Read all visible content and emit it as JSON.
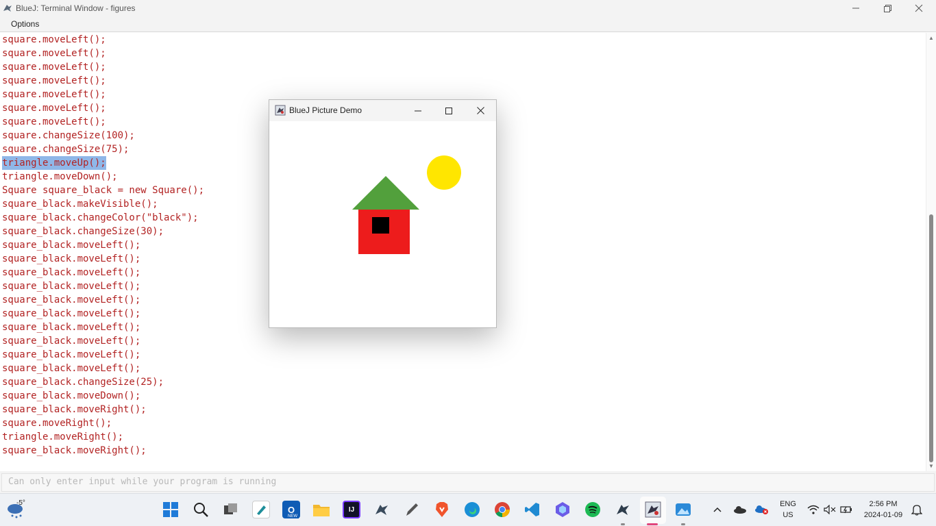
{
  "window": {
    "title": "BlueJ: Terminal Window - figures",
    "menu": "Options"
  },
  "terminal": {
    "lines": [
      "square.moveLeft();",
      "square.moveLeft();",
      "square.moveLeft();",
      "square.moveLeft();",
      "square.moveLeft();",
      "square.moveLeft();",
      "square.moveLeft();",
      "square.changeSize(100);",
      "square.changeSize(75);",
      "triangle.moveUp();",
      "triangle.moveDown();",
      "Square square_black = new Square();",
      "square_black.makeVisible();",
      "square_black.changeColor(\"black\");",
      "square_black.changeSize(30);",
      "square_black.moveLeft();",
      "square_black.moveLeft();",
      "square_black.moveLeft();",
      "square_black.moveLeft();",
      "square_black.moveLeft();",
      "square_black.moveLeft();",
      "square_black.moveLeft();",
      "square_black.moveLeft();",
      "square_black.moveLeft();",
      "square_black.moveLeft();",
      "square_black.changeSize(25);",
      "square_black.moveDown();",
      "square_black.moveRight();",
      "square.moveRight();",
      "triangle.moveRight();",
      "square_black.moveRight();"
    ],
    "selected_line": 9,
    "input_placeholder": "Can only enter input while your program is running"
  },
  "demo_window": {
    "title": "BlueJ Picture Demo",
    "colors": {
      "sun": "#ffe600",
      "roof": "#52a03c",
      "wall": "#ed1c1c",
      "window": "#000000"
    }
  },
  "taskbar": {
    "weather": "-5°",
    "language": "ENG",
    "region": "US",
    "time": "2:56 PM",
    "date": "2024-01-09",
    "new_badge": "NEW"
  }
}
